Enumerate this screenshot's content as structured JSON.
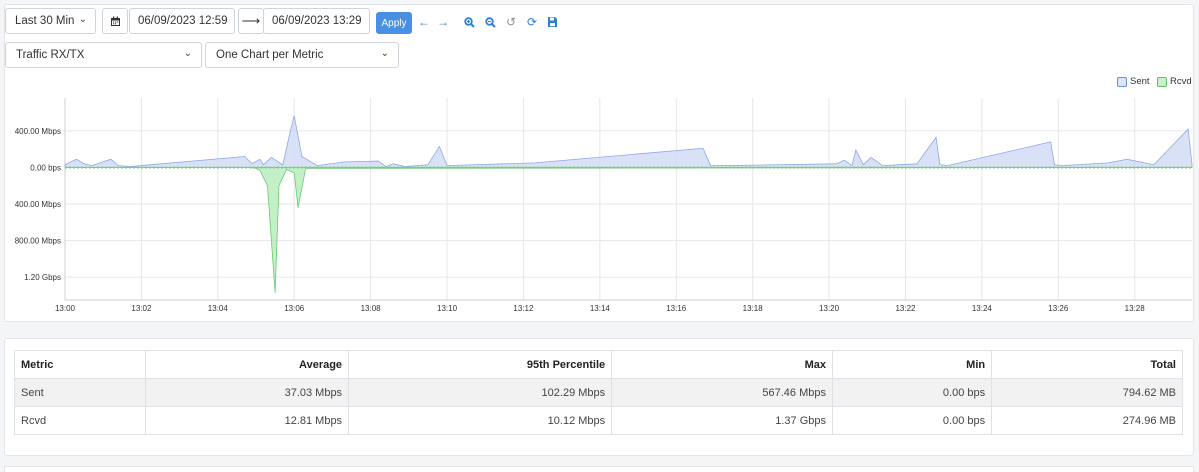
{
  "toolbar": {
    "range_label": "Last 30 Min",
    "start_value": "06/09/2023 12:59",
    "end_value": "06/09/2023 13:29",
    "apply_label": "Apply",
    "calendar_icon": "calendar-icon",
    "arrow_icon": "arrow-right-icon",
    "nav_icons": [
      "arrow-left-icon",
      "arrow-right-icon",
      "zoom-in-icon",
      "zoom-out-icon",
      "undo-icon",
      "refresh-icon",
      "save-icon"
    ]
  },
  "filters": {
    "metric_value": "Traffic RX/TX",
    "layout_value": "One Chart per Metric"
  },
  "legend": {
    "sent_label": "Sent",
    "rcvd_label": "Rcvd",
    "sent_color": "#6b8fd6",
    "rcvd_color": "#5fc066"
  },
  "chart_data": {
    "type": "area",
    "x_ticks": [
      "13:00",
      "13:02",
      "13:04",
      "13:06",
      "13:08",
      "13:10",
      "13:12",
      "13:14",
      "13:16",
      "13:18",
      "13:20",
      "13:22",
      "13:24",
      "13:26",
      "13:28"
    ],
    "y_ticks": [
      "400.00 Mbps",
      "0.00 bps",
      "400.00 Mbps",
      "800.00 Mbps",
      "1.20 Gbps"
    ],
    "y_units": "Mbps (Rcvd plotted downward)",
    "ylim": [
      -1450,
      760
    ],
    "grid": true,
    "legend_position": "top-right",
    "series": [
      {
        "name": "Sent",
        "color": "#6b8fd6",
        "x": [
          0,
          0.3,
          0.5,
          0.7,
          1.2,
          1.4,
          1.7,
          4.7,
          4.9,
          5.1,
          5.2,
          5.4,
          5.7,
          5.9,
          6.0,
          6.2,
          6.6,
          7.3,
          8.2,
          8.4,
          8.6,
          8.9,
          9.5,
          9.8,
          10.0,
          12.3,
          16.7,
          16.9,
          17.2,
          20.2,
          20.4,
          20.6,
          20.7,
          20.9,
          21.1,
          21.4,
          22.3,
          22.8,
          22.9,
          23.1,
          25.8,
          25.9,
          26.1,
          27.3,
          27.8,
          28.5,
          29.4,
          29.5
        ],
        "values": [
          30,
          90,
          40,
          20,
          90,
          20,
          10,
          120,
          40,
          90,
          30,
          110,
          30,
          400,
          567,
          120,
          20,
          60,
          70,
          10,
          40,
          10,
          30,
          230,
          20,
          50,
          210,
          20,
          20,
          40,
          80,
          20,
          190,
          30,
          110,
          20,
          40,
          330,
          30,
          20,
          280,
          30,
          20,
          50,
          90,
          30,
          420,
          30
        ]
      },
      {
        "name": "Rcvd",
        "color": "#5fc066",
        "x": [
          0,
          4.8,
          5.0,
          5.1,
          5.3,
          5.5,
          5.6,
          5.8,
          6.0,
          6.1,
          6.3,
          29.5
        ],
        "values": [
          0,
          0,
          -10,
          -30,
          -200,
          -1370,
          -200,
          -20,
          -60,
          -440,
          -10,
          0
        ]
      }
    ]
  },
  "table": {
    "headers": [
      "Metric",
      "Average",
      "95th Percentile",
      "Max",
      "Min",
      "Total"
    ],
    "rows": [
      [
        "Sent",
        "37.03 Mbps",
        "102.29 Mbps",
        "567.46 Mbps",
        "0.00 bps",
        "794.62 MB"
      ],
      [
        "Rcvd",
        "12.81 Mbps",
        "10.12 Mbps",
        "1.37 Gbps",
        "0.00 bps",
        "274.96 MB"
      ]
    ]
  }
}
